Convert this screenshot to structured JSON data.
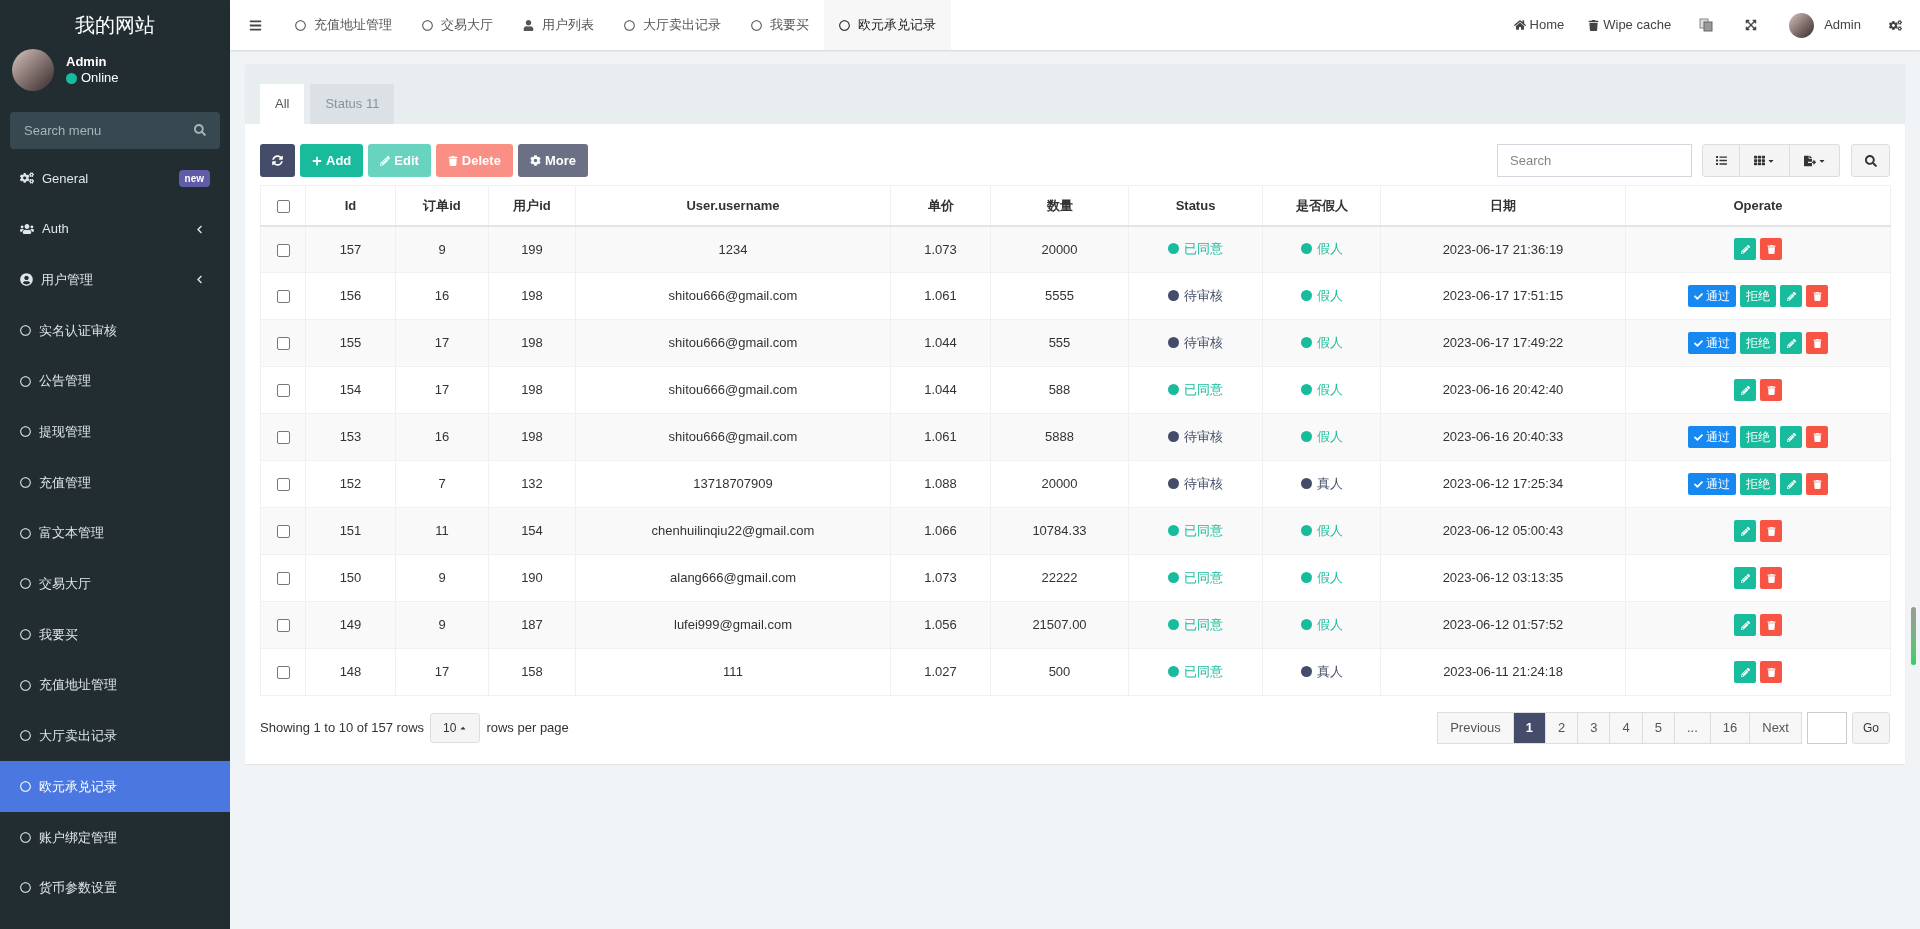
{
  "sidebar": {
    "title": "我的网站",
    "user": {
      "name": "Admin",
      "status": "Online"
    },
    "search": {
      "placeholder": "Search menu"
    },
    "items": [
      {
        "label": "General",
        "kind": "gears",
        "badge": "new",
        "expandable": false,
        "selected": false
      },
      {
        "label": "Auth",
        "kind": "users",
        "expandable": true,
        "selected": false
      },
      {
        "label": "用户管理",
        "kind": "user-circle",
        "expandable": true,
        "selected": false
      },
      {
        "label": "实名认证审核",
        "kind": "circle",
        "expandable": false,
        "selected": false
      },
      {
        "label": "公告管理",
        "kind": "circle",
        "expandable": false,
        "selected": false
      },
      {
        "label": "提现管理",
        "kind": "circle",
        "expandable": false,
        "selected": false
      },
      {
        "label": "充值管理",
        "kind": "circle",
        "expandable": false,
        "selected": false
      },
      {
        "label": "富文本管理",
        "kind": "circle",
        "expandable": false,
        "selected": false
      },
      {
        "label": "交易大厅",
        "kind": "circle",
        "expandable": false,
        "selected": false
      },
      {
        "label": "我要买",
        "kind": "circle",
        "expandable": false,
        "selected": false
      },
      {
        "label": "充值地址管理",
        "kind": "circle",
        "expandable": false,
        "selected": false
      },
      {
        "label": "大厅卖出记录",
        "kind": "circle",
        "expandable": false,
        "selected": false
      },
      {
        "label": "欧元承兑记录",
        "kind": "circle",
        "expandable": false,
        "selected": true
      },
      {
        "label": "账户绑定管理",
        "kind": "circle",
        "expandable": false,
        "selected": false
      },
      {
        "label": "货币参数设置",
        "kind": "circle",
        "expandable": false,
        "selected": false
      }
    ]
  },
  "header": {
    "nav_tabs": [
      {
        "label": "充值地址管理",
        "kind": "circle",
        "selected": false
      },
      {
        "label": "交易大厅",
        "kind": "circle",
        "selected": false
      },
      {
        "label": "用户列表",
        "kind": "user",
        "selected": false
      },
      {
        "label": "大厅卖出记录",
        "kind": "circle",
        "selected": false
      },
      {
        "label": "我要买",
        "kind": "circle",
        "selected": false
      },
      {
        "label": "欧元承兑记录",
        "kind": "circle",
        "selected": true
      }
    ],
    "right": [
      {
        "kind": "home",
        "label": "Home"
      },
      {
        "kind": "trash",
        "label": "Wipe cache"
      },
      {
        "kind": "language"
      },
      {
        "kind": "fullscreen"
      },
      {
        "kind": "user",
        "label": "Admin"
      },
      {
        "kind": "settings"
      }
    ]
  },
  "tabs": [
    {
      "label": "All",
      "selected": true
    },
    {
      "label": "Status 11",
      "selected": false
    }
  ],
  "toolbar": {
    "buttons": [
      {
        "kind": "refresh",
        "disabled": false
      },
      {
        "kind": "add",
        "label": "Add",
        "disabled": false
      },
      {
        "kind": "edit",
        "label": "Edit",
        "disabled": true
      },
      {
        "kind": "delete",
        "label": "Delete",
        "disabled": true
      },
      {
        "kind": "more",
        "label": "More",
        "disabled": false
      }
    ],
    "search": {
      "placeholder": "Search"
    }
  },
  "table": {
    "select_all_checked": false,
    "columns": [
      "Id",
      "订单id",
      "用户id",
      "User.username",
      "单价",
      "数量",
      "Status",
      "是否假人",
      "日期",
      "Operate"
    ],
    "rows": [
      {
        "checked": false,
        "cells": [
          "157",
          "9",
          "199",
          "1234",
          "1.073",
          "20000"
        ],
        "status": {
          "label": "已同意",
          "color": "#18bc9c"
        },
        "fake": {
          "label": "假人",
          "color": "#18bc9c"
        },
        "date": "2023-06-17 21:36:19",
        "actions": []
      },
      {
        "checked": false,
        "cells": [
          "156",
          "16",
          "198",
          "shitou666@gmail.com",
          "1.061",
          "5555"
        ],
        "status": {
          "label": "待审核",
          "color": "#444c69"
        },
        "fake": {
          "label": "假人",
          "color": "#18bc9c"
        },
        "date": "2023-06-17 17:51:15",
        "actions": [
          "通过",
          "拒绝"
        ]
      },
      {
        "checked": false,
        "cells": [
          "155",
          "17",
          "198",
          "shitou666@gmail.com",
          "1.044",
          "555"
        ],
        "status": {
          "label": "待审核",
          "color": "#444c69"
        },
        "fake": {
          "label": "假人",
          "color": "#18bc9c"
        },
        "date": "2023-06-17 17:49:22",
        "actions": [
          "通过",
          "拒绝"
        ]
      },
      {
        "checked": false,
        "cells": [
          "154",
          "17",
          "198",
          "shitou666@gmail.com",
          "1.044",
          "588"
        ],
        "status": {
          "label": "已同意",
          "color": "#18bc9c"
        },
        "fake": {
          "label": "假人",
          "color": "#18bc9c"
        },
        "date": "2023-06-16 20:42:40",
        "actions": []
      },
      {
        "checked": false,
        "cells": [
          "153",
          "16",
          "198",
          "shitou666@gmail.com",
          "1.061",
          "5888"
        ],
        "status": {
          "label": "待审核",
          "color": "#444c69"
        },
        "fake": {
          "label": "假人",
          "color": "#18bc9c"
        },
        "date": "2023-06-16 20:40:33",
        "actions": [
          "通过",
          "拒绝"
        ]
      },
      {
        "checked": false,
        "cells": [
          "152",
          "7",
          "132",
          "13718707909",
          "1.088",
          "20000"
        ],
        "status": {
          "label": "待审核",
          "color": "#444c69"
        },
        "fake": {
          "label": "真人",
          "color": "#444c69"
        },
        "date": "2023-06-12 17:25:34",
        "actions": [
          "通过",
          "拒绝"
        ]
      },
      {
        "checked": false,
        "cells": [
          "151",
          "11",
          "154",
          "chenhuilinqiu22@gmail.com",
          "1.066",
          "10784.33"
        ],
        "status": {
          "label": "已同意",
          "color": "#18bc9c"
        },
        "fake": {
          "label": "假人",
          "color": "#18bc9c"
        },
        "date": "2023-06-12 05:00:43",
        "actions": []
      },
      {
        "checked": false,
        "cells": [
          "150",
          "9",
          "190",
          "alang666@gmail.com",
          "1.073",
          "22222"
        ],
        "status": {
          "label": "已同意",
          "color": "#18bc9c"
        },
        "fake": {
          "label": "假人",
          "color": "#18bc9c"
        },
        "date": "2023-06-12 03:13:35",
        "actions": []
      },
      {
        "checked": false,
        "cells": [
          "149",
          "9",
          "187",
          "lufei999@gmail.com",
          "1.056",
          "21507.00"
        ],
        "status": {
          "label": "已同意",
          "color": "#18bc9c"
        },
        "fake": {
          "label": "假人",
          "color": "#18bc9c"
        },
        "date": "2023-06-12 01:57:52",
        "actions": []
      },
      {
        "checked": false,
        "cells": [
          "148",
          "17",
          "158",
          "111",
          "1.027",
          "500"
        ],
        "status": {
          "label": "已同意",
          "color": "#18bc9c"
        },
        "fake": {
          "label": "真人",
          "color": "#444c69"
        },
        "date": "2023-06-11 21:24:18",
        "actions": []
      }
    ]
  },
  "pagination": {
    "summary": "Showing 1 to 10 of 157 rows",
    "page_size": "10",
    "page_size_label": "rows per page",
    "pages": [
      {
        "label": "Previous",
        "selected": false
      },
      {
        "label": "1",
        "selected": true
      },
      {
        "label": "2",
        "selected": false
      },
      {
        "label": "3",
        "selected": false
      },
      {
        "label": "4",
        "selected": false
      },
      {
        "label": "5",
        "selected": false
      },
      {
        "label": "...",
        "selected": false
      },
      {
        "label": "16",
        "selected": false
      },
      {
        "label": "Next",
        "selected": false
      }
    ],
    "go": "Go"
  }
}
